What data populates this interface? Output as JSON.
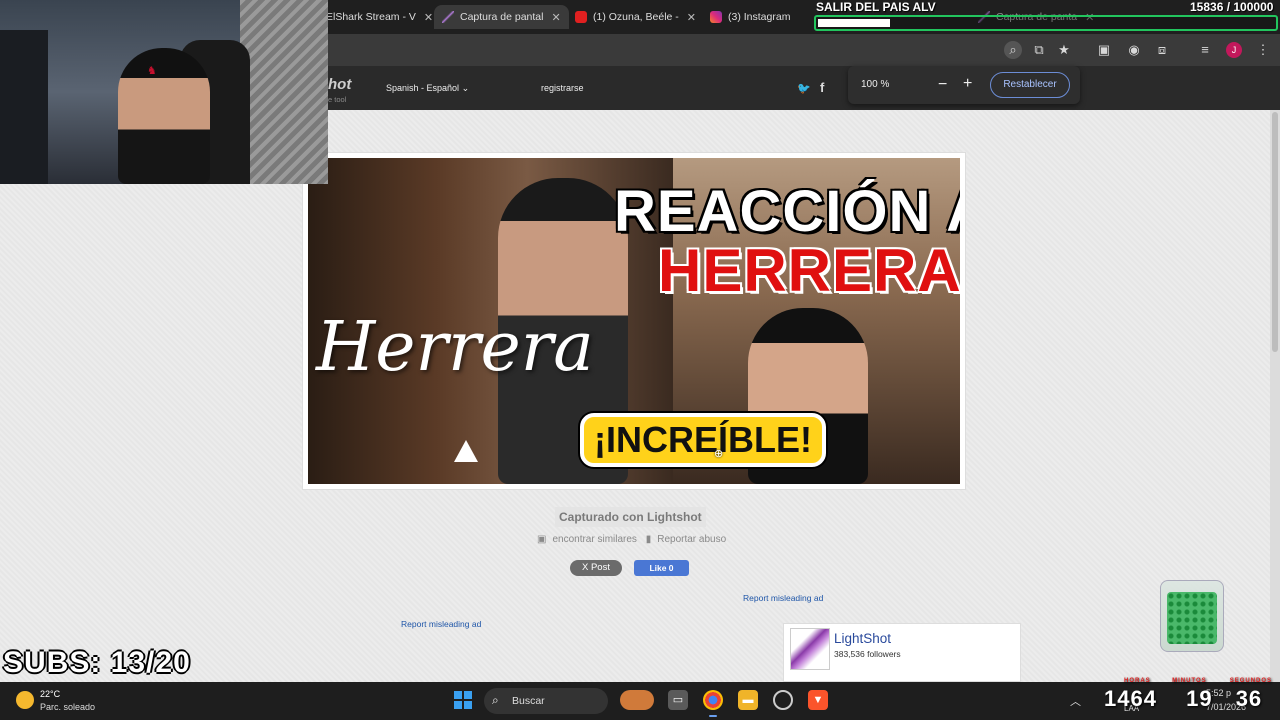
{
  "browser": {
    "tabs": [
      {
        "label": "ElShark Stream - V",
        "icon": "site-icon",
        "active": false
      },
      {
        "label": "Captura de pantal",
        "icon": "lightshot-feather-icon",
        "active": true
      },
      {
        "label": "(1) Ozuna, Beéle -",
        "icon": "youtube-icon",
        "active": false
      },
      {
        "label": "(3) Instagram",
        "icon": "instagram-icon",
        "active": false
      },
      {
        "label": "Captura de panta",
        "icon": "lightshot-feather-icon",
        "active": false
      }
    ]
  },
  "site_header": {
    "logo": "hot",
    "logo_sub": "e tool",
    "language": "Spanish - Español",
    "register": "registrarse"
  },
  "zoom_popup": {
    "value": "100 %",
    "minus": "−",
    "plus": "+",
    "reset": "Restablecer"
  },
  "thumbnail": {
    "title_line1": "REACCIÓN A",
    "title_line2": "HERRERA",
    "script_text": "Herrera",
    "bubble": "¡INCREÍBLE!"
  },
  "page": {
    "captured": "Capturado con Lightshot",
    "find_similar": "encontrar similares",
    "report_abuse": "Reportar abuso",
    "x_post": "X Post",
    "fb_like": "Like 0",
    "report_ad": "Report misleading ad"
  },
  "fb_card": {
    "name": "LightShot",
    "followers": "383,536 followers"
  },
  "stream": {
    "goal_title": "SALIR DEL PAIS ALV",
    "goal_count": "15836 / 100000",
    "goal_progress": 0.158,
    "subs": "SUBS: 13/20",
    "timer_hours": "1464",
    "timer_minutes": "19",
    "timer_seconds": "36",
    "timer_label_h": "HORAS",
    "timer_label_m": "MINUTOS",
    "timer_label_s": "SEGUNDOS"
  },
  "taskbar": {
    "temp": "22°C",
    "weather": "Parc. soleado",
    "search": "Buscar",
    "lang": "LAA",
    "time": "5:52 p",
    "date": "7/01/2026"
  },
  "colors": {
    "accent_blue": "#1f56a8",
    "goal_green": "#22c55e",
    "title_red": "#e01010",
    "bubble_yellow": "#ffd21a"
  }
}
